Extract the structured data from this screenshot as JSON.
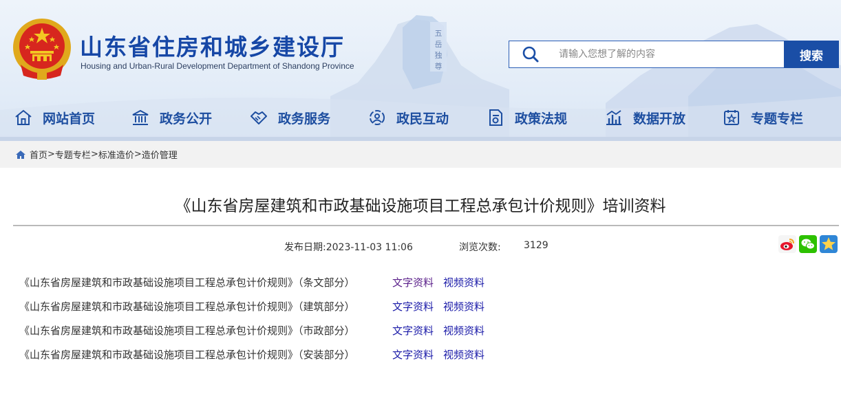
{
  "header": {
    "site_title": "山东省住房和城乡建设厅",
    "site_subtitle": "Housing and Urban-Rural Development Department of Shandong Province",
    "search": {
      "placeholder": "请输入您想了解的内容",
      "button_label": "搜索"
    }
  },
  "nav": {
    "items": [
      {
        "label": "网站首页",
        "icon": "home-icon"
      },
      {
        "label": "政务公开",
        "icon": "government-building-icon"
      },
      {
        "label": "政务服务",
        "icon": "handshake-icon"
      },
      {
        "label": "政民互动",
        "icon": "interaction-icon"
      },
      {
        "label": "政策法规",
        "icon": "document-icon"
      },
      {
        "label": "数据开放",
        "icon": "data-chart-icon"
      },
      {
        "label": "专题专栏",
        "icon": "column-icon"
      }
    ]
  },
  "breadcrumb": {
    "items": [
      "首页",
      "专题专栏",
      "标准造价",
      "造价管理"
    ],
    "separator": ">"
  },
  "article": {
    "title": "《山东省房屋建筑和市政基础设施项目工程总承包计价规则》培训资料",
    "date_label": "发布日期:",
    "date": "2023-11-03 11:06",
    "views_label": "浏览次数:",
    "views": "3129",
    "documents": [
      {
        "name": "《山东省房屋建筑和市政基础设施项目工程总承包计价规则》（条文部分）",
        "text_link": "文字资料",
        "video_link": "视频资料"
      },
      {
        "name": "《山东省房屋建筑和市政基础设施项目工程总承包计价规则》（建筑部分）",
        "text_link": "文字资料",
        "video_link": "视频资料"
      },
      {
        "name": "《山东省房屋建筑和市政基础设施项目工程总承包计价规则》（市政部分）",
        "text_link": "文字资料",
        "video_link": "视频资料"
      },
      {
        "name": "《山东省房屋建筑和市政基础设施项目工程总承包计价规则》（安装部分）",
        "text_link": "文字资料",
        "video_link": "视频资料"
      }
    ]
  },
  "share": {
    "icons": [
      "weibo-icon",
      "wechat-icon",
      "favorite-star-icon"
    ]
  },
  "colors": {
    "brand_blue": "#1a4ea6",
    "nav_text": "#1d4ea0",
    "link": "#1a1aa8",
    "visited_link": "#5a1f8a"
  }
}
